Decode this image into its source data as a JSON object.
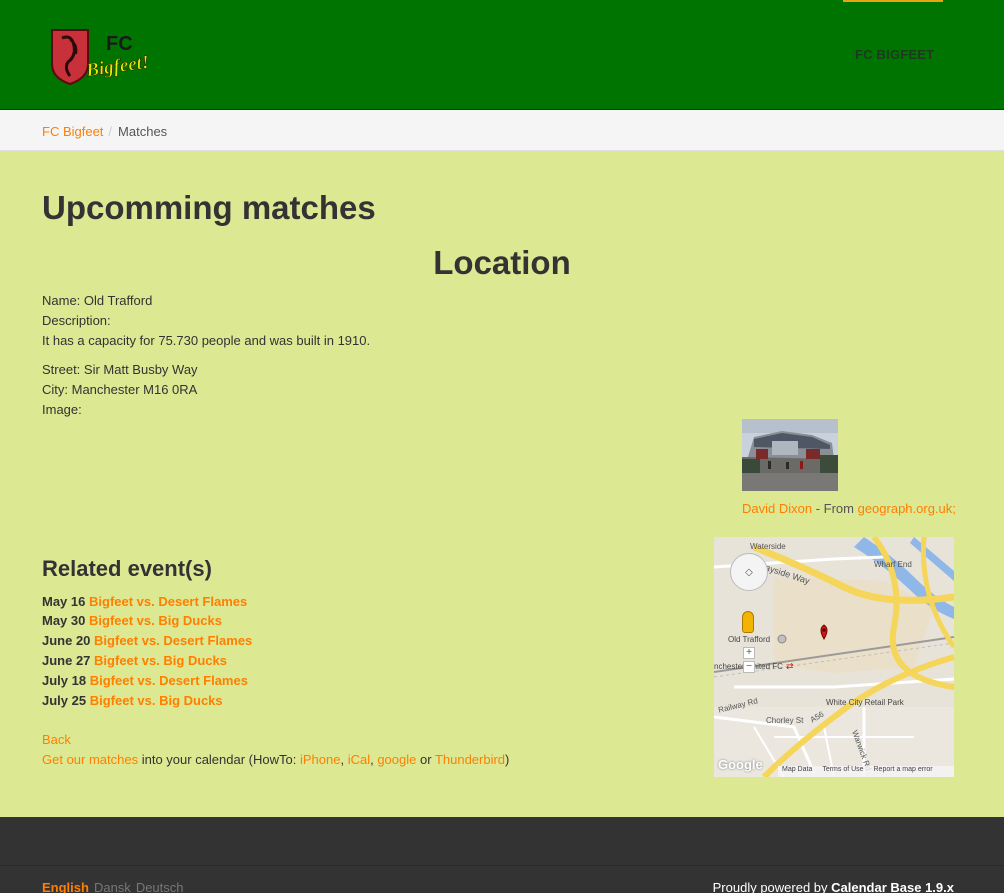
{
  "header": {
    "logo_text_fc": "FC",
    "logo_text_name": "Bigfeet!",
    "brand_link": "FC BIGFEET"
  },
  "breadcrumb": {
    "home": "FC Bigfeet",
    "separator": "/",
    "current": "Matches"
  },
  "main": {
    "title": "Upcomming matches",
    "location_heading": "Location",
    "name_line": "Name: Old Trafford",
    "description_label": "Description:",
    "description": "It has a capacity for 75.730 people and was built in 1910.",
    "street_line": "Street: Sir Matt Busby Way",
    "city_line": "City: Manchester M16 0RA",
    "image_label": "Image:",
    "credit_author": "David Dixon",
    "credit_middle": " - From ",
    "credit_source": "geograph.org.uk;"
  },
  "map": {
    "labels": {
      "waterside": "Waterside",
      "quayside": "ayside Way",
      "wharf": "Wharf End",
      "old_trafford": "Old Trafford",
      "manchester_united": "nchester United FC",
      "railway": "Railway Rd",
      "chorley": "Chorley St",
      "a56": "A56",
      "white_city": "White City Retail Park",
      "warwick": "Warwick Rd"
    },
    "zoom_in": "+",
    "zoom_out": "−",
    "google": "Google",
    "map_data": "Map Data",
    "terms": "Terms of Use",
    "report": "Report a map error"
  },
  "related": {
    "heading": "Related event(s)",
    "events": [
      {
        "date": "May 16",
        "title": "Bigfeet vs. Desert Flames"
      },
      {
        "date": "May 30",
        "title": "Bigfeet vs. Big Ducks"
      },
      {
        "date": "June 20",
        "title": "Bigfeet vs. Desert Flames"
      },
      {
        "date": "June 27",
        "title": "Bigfeet vs. Big Ducks"
      },
      {
        "date": "July 18",
        "title": "Bigfeet vs. Desert Flames"
      },
      {
        "date": "July 25",
        "title": "Bigfeet vs. Big Ducks"
      }
    ],
    "back": "Back",
    "get_matches": "Get our matches",
    "into_calendar": " into your calendar (HowTo: ",
    "iphone": "iPhone",
    "comma1": ", ",
    "ical": "iCal",
    "comma2": ", ",
    "google": "google",
    "or": " or ",
    "thunderbird": "Thunderbird",
    "close": ")"
  },
  "footer": {
    "lang_current": "English",
    "lang_dansk": "Dansk",
    "lang_deutsch": "Deutsch",
    "powered_prefix": "Proudly powered by ",
    "powered_product": "Calendar Base 1.9.x"
  },
  "colors": {
    "header_green": "#007400",
    "content_bg": "#dde893",
    "link_orange": "#ff7f00",
    "footer_bg": "#333333"
  }
}
